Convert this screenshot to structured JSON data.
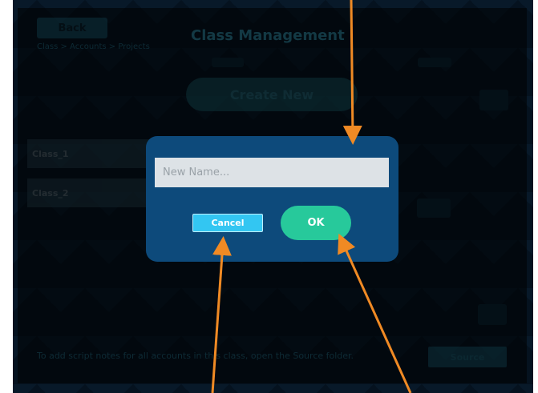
{
  "header": {
    "back_label": "Back",
    "title": "Class Management",
    "breadcrumb": "Class  >  Accounts  >  Projects"
  },
  "main": {
    "create_new_label": "Create New",
    "classes": [
      {
        "label": "Class_1"
      },
      {
        "label": "Class_2"
      }
    ]
  },
  "footer": {
    "hint": "To add script notes for all accounts in this class, open the Source folder.",
    "source_label": "Source"
  },
  "dialog": {
    "name_placeholder": "New Name...",
    "name_value": "",
    "cancel_label": "Cancel",
    "ok_label": "OK"
  },
  "colors": {
    "dialog_bg": "#0d4a7b",
    "ok_green": "#27c99b",
    "cancel_cyan": "#33c6f2",
    "arrow_orange": "#f08a24"
  }
}
